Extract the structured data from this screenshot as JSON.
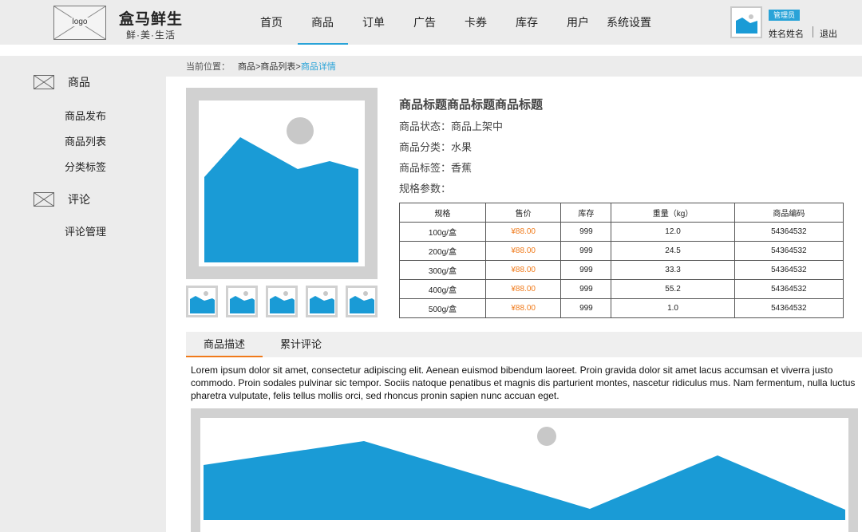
{
  "header": {
    "logo_text": "logo",
    "brand_title": "盒马鲜生",
    "brand_sub": "鲜·美·生活",
    "nav": [
      "首页",
      "商品",
      "订单",
      "广告",
      "卡券",
      "库存",
      "用户",
      "系统设置"
    ],
    "active_nav": "商品",
    "role_badge": "管理员",
    "user_name": "姓名姓名",
    "logout": "退出"
  },
  "sidebar": {
    "groups": [
      {
        "title": "商品",
        "icon": "mail-icon",
        "items": [
          "商品发布",
          "商品列表",
          "分类标签"
        ]
      },
      {
        "title": "评论",
        "icon": "mail-icon",
        "items": [
          "评论管理"
        ]
      }
    ]
  },
  "breadcrumb": {
    "label": "当前位置：",
    "path": "商品>商品列表>",
    "current": "商品详情"
  },
  "product": {
    "title": "商品标题商品标题商品标题",
    "status": "商品状态：商品上架中",
    "category": "商品分类：水果",
    "tag": "商品标签：香蕉",
    "specs_label": "规格参数："
  },
  "specs_table": {
    "headers": [
      "规格",
      "售价",
      "库存",
      "重量（kg）",
      "商品编码"
    ],
    "rows": [
      [
        "100g/盒",
        "¥88.00",
        "999",
        "12.0",
        "54364532"
      ],
      [
        "200g/盒",
        "¥88.00",
        "999",
        "24.5",
        "54364532"
      ],
      [
        "300g/盒",
        "¥88.00",
        "999",
        "33.3",
        "54364532"
      ],
      [
        "400g/盒",
        "¥88.00",
        "999",
        "55.2",
        "54364532"
      ],
      [
        "500g/盒",
        "¥88.00",
        "999",
        "1.0",
        "54364532"
      ]
    ]
  },
  "tabs": [
    "商品描述",
    "累计评论"
  ],
  "active_tab": "商品描述",
  "description": "Lorem ipsum dolor sit amet, consectetur adipiscing elit. Aenean euismod bibendum laoreet. Proin gravida dolor sit amet lacus accumsan et viverra justo commodo. Proin sodales pulvinar sic tempor. Sociis natoque penatibus et magnis dis parturient montes, nascetur ridiculus mus. Nam fermentum, nulla luctus pharetra vulputate, felis tellus mollis orci, sed rhoncus pronin sapien nunc accuan eget.",
  "colors": {
    "accent_blue": "#29a3d8",
    "price_orange": "#f07a1a",
    "image_blue": "#1a9bd6",
    "placeholder_gray": "#d1d1d1"
  }
}
